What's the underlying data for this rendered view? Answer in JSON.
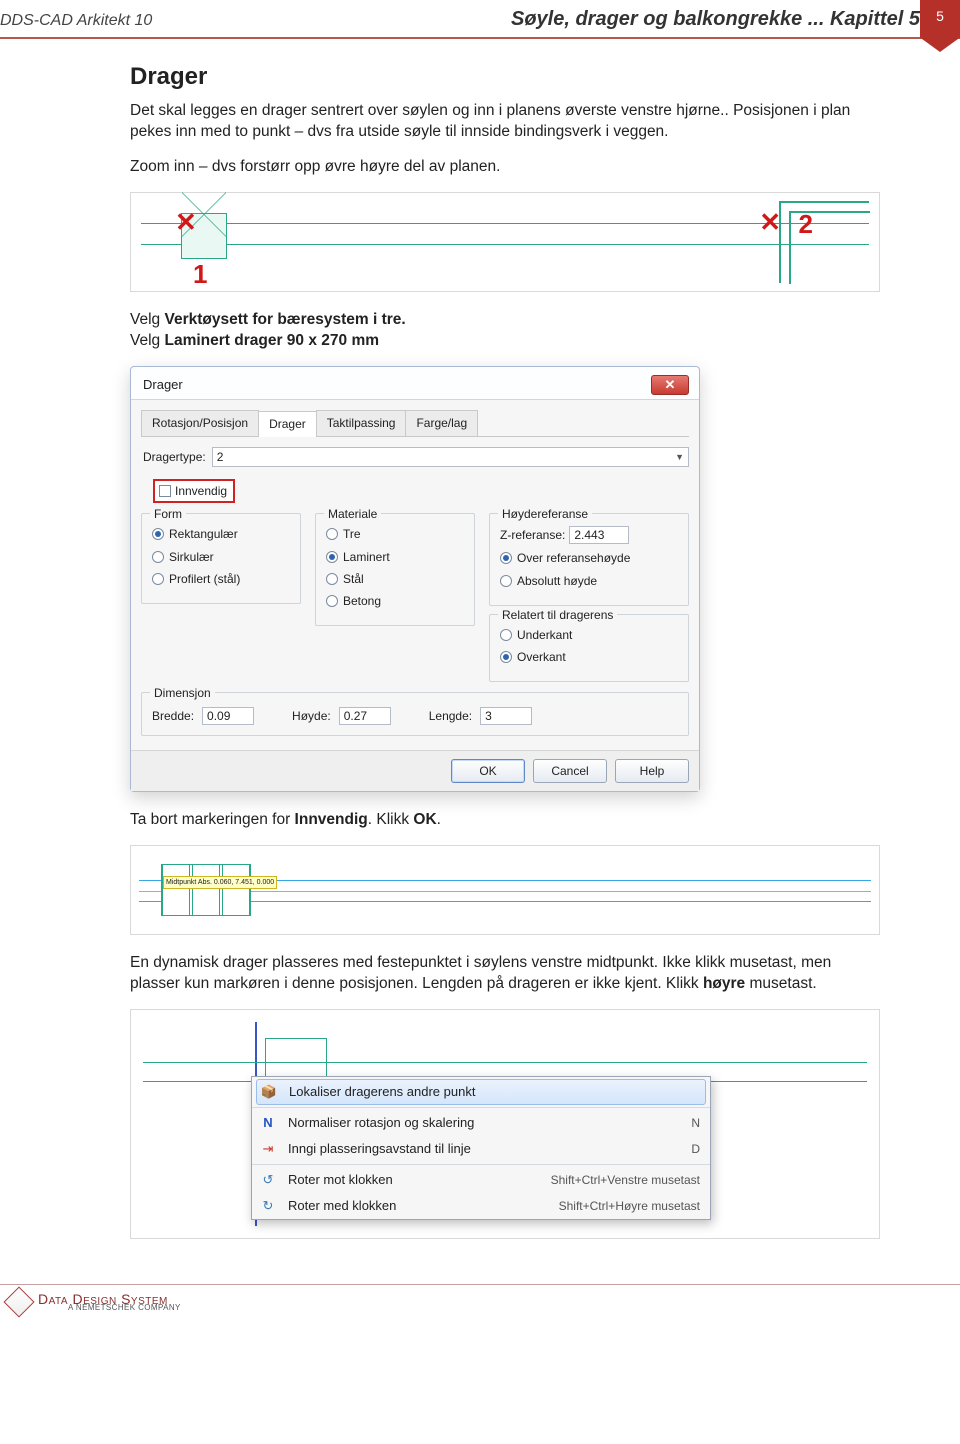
{
  "page_number": "5",
  "header": {
    "left": "DDS-CAD Arkitekt 10",
    "right": "Søyle, drager og balkongrekke ... Kapittel 5"
  },
  "section_title": "Drager",
  "paragraphs": {
    "p1": "Det skal legges en drager sentrert over søylen og inn i planens øverste venstre hjørne.. Posisjonen i plan pekes inn med to punkt – dvs fra utside søyle til innside bindingsverk i veggen.",
    "p2": "Zoom inn – dvs forstørr opp øvre høyre del av planen.",
    "p3a": "Velg ",
    "p3b": "Verktøysett for bæresystem i tre.",
    "p4a": "Velg ",
    "p4b": "Laminert drager 90 x 270 mm",
    "p5a": "Ta bort markeringen for ",
    "p5b": "Innvendig",
    "p5c": ". Klikk ",
    "p5d": "OK",
    "p5e": ".",
    "p6a": "En dynamisk drager plasseres med festepunktet i søylens venstre midtpunkt. Ikke klikk musetast, men plasser kun markøren i denne posisjonen. Lengden på drageren er ikke kjent. Klikk ",
    "p6b": "høyre",
    "p6c": " musetast."
  },
  "fig1": {
    "mark1": "1",
    "mark2": "2",
    "x": "✕"
  },
  "dialog": {
    "title": "Drager",
    "close": "✕",
    "tabs": [
      "Rotasjon/Posisjon",
      "Drager",
      "Taktilpassing",
      "Farge/lag"
    ],
    "active_tab": 1,
    "type_label": "Dragertype:",
    "type_value": "2",
    "innvendig": "Innvendig",
    "groups": {
      "form": {
        "legend": "Form",
        "opts": [
          "Rektangulær",
          "Sirkulær",
          "Profilert (stål)"
        ],
        "selected": 0
      },
      "materiale": {
        "legend": "Materiale",
        "opts": [
          "Tre",
          "Laminert",
          "Stål",
          "Betong"
        ],
        "selected": 1
      },
      "hoyderef": {
        "legend": "Høydereferanse",
        "z_label": "Z-referanse:",
        "z_value": "2.443",
        "opts": [
          "Over referansehøyde",
          "Absolutt høyde"
        ],
        "selected": 0
      },
      "relatert": {
        "legend": "Relatert til dragerens",
        "opts": [
          "Underkant",
          "Overkant"
        ],
        "selected": 1
      },
      "dimensjon": {
        "legend": "Dimensjon",
        "bredde_l": "Bredde:",
        "bredde_v": "0.09",
        "hoyde_l": "Høyde:",
        "hoyde_v": "0.27",
        "lengde_l": "Lengde:",
        "lengde_v": "3"
      }
    },
    "buttons": {
      "ok": "OK",
      "cancel": "Cancel",
      "help": "Help"
    }
  },
  "fig3": {
    "tag": "Midtpunkt\nAbs. 0.060, 7.451, 0.000"
  },
  "context_menu": {
    "items": [
      {
        "icon": "📦",
        "label": "Lokaliser dragerens andre punkt",
        "shortcut": "",
        "hover": true
      },
      {
        "icon": "N",
        "label": "Normaliser rotasjon og skalering",
        "shortcut": "N"
      },
      {
        "icon": "⇥",
        "label": "Inngi plasseringsavstand til linje",
        "shortcut": "D"
      },
      {
        "icon": "↺",
        "label": "Roter mot klokken",
        "shortcut": "Shift+Ctrl+Venstre musetast"
      },
      {
        "icon": "↻",
        "label": "Roter med klokken",
        "shortcut": "Shift+Ctrl+Høyre musetast"
      }
    ]
  },
  "footer": {
    "brand": "Data Design System",
    "sub": "A NEMETSCHEK COMPANY"
  }
}
